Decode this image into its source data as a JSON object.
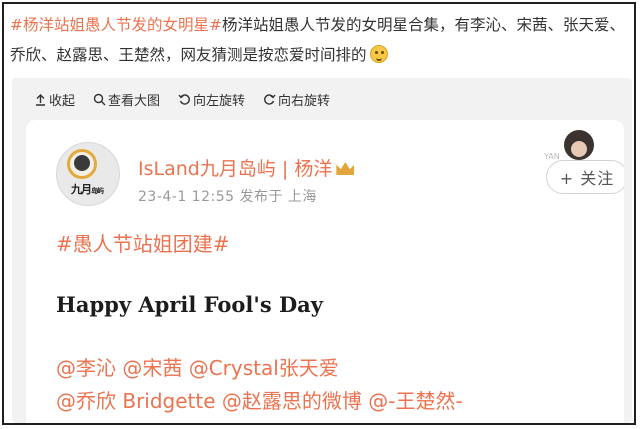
{
  "post": {
    "topic": "#杨洋站姐愚人节发的女明星#",
    "body": "杨洋站姐愚人节发的女明星合集，有李沁、宋茜、张天爱、乔欣、赵露思、王楚然，网友猜测是按恋爱时间排的"
  },
  "toolbar": {
    "collapse": "收起",
    "view_large": "查看大图",
    "rotate_left": "向左旋转",
    "rotate_right": "向右旋转"
  },
  "card": {
    "avatar_brand": "九月",
    "avatar_brand_small": "岛屿",
    "account_name": "IsLand九月岛屿 | 杨洋",
    "meta": "23-4-1 12:55  发布于 上海",
    "follow_label": "+ 关注",
    "peek_text": "YAN",
    "hashtag": "#愚人节站姐团建#",
    "headline": "Happy April Fool's Day",
    "mentions_line1": "@李沁 @宋茜 @Crystal张天爱",
    "mentions_line2": "@乔欣 Bridgette @赵露思的微博 @-王楚然-"
  },
  "colors": {
    "link": "#eb7350",
    "viewer_bg": "#f2f2f2",
    "meta_text": "#999999"
  },
  "icons": [
    "collapse-icon",
    "search-icon",
    "rotate-left-icon",
    "rotate-right-icon",
    "smile-emoji-icon",
    "crown-icon"
  ]
}
